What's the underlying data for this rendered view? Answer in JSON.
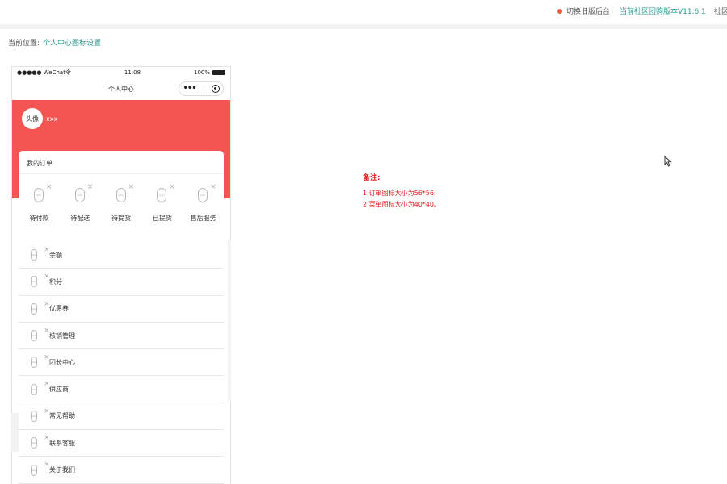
{
  "topbar": {
    "switch_label": "切换旧版后台",
    "version_label": "当前社区团购版本V11.6.1",
    "more_label": "社区"
  },
  "breadcrumb": {
    "prefix": "当前位置:",
    "current": "个人中心图标设置"
  },
  "phone": {
    "status": {
      "carrier": "●●●●● WeChat令",
      "time": "11:08",
      "battery": "100%"
    },
    "nav_title": "个人中心",
    "user": {
      "avatar_text": "头像",
      "name": "xxx"
    },
    "orders": {
      "title": "我的订单",
      "items": [
        {
          "label": "待付款"
        },
        {
          "label": "待配送"
        },
        {
          "label": "待提货"
        },
        {
          "label": "已提货"
        },
        {
          "label": "售后服务"
        }
      ]
    },
    "menu": [
      {
        "label": "余额"
      },
      {
        "label": "积分"
      },
      {
        "label": "优惠券"
      },
      {
        "label": "核销管理"
      },
      {
        "label": "团长中心"
      },
      {
        "label": "供应商"
      },
      {
        "label": "常见帮助"
      },
      {
        "label": "联系客服"
      },
      {
        "label": "关于我们"
      }
    ],
    "icon_placeholder": "icon",
    "remove_glyph": "×"
  },
  "notes": {
    "title": "备注:",
    "lines": [
      "1.订单图标大小为56*56;",
      "2.菜单图标大小为40*40。"
    ]
  },
  "colors": {
    "accent": "#2b9b8f",
    "header_red": "#f55552",
    "note_red": "#e02020"
  }
}
